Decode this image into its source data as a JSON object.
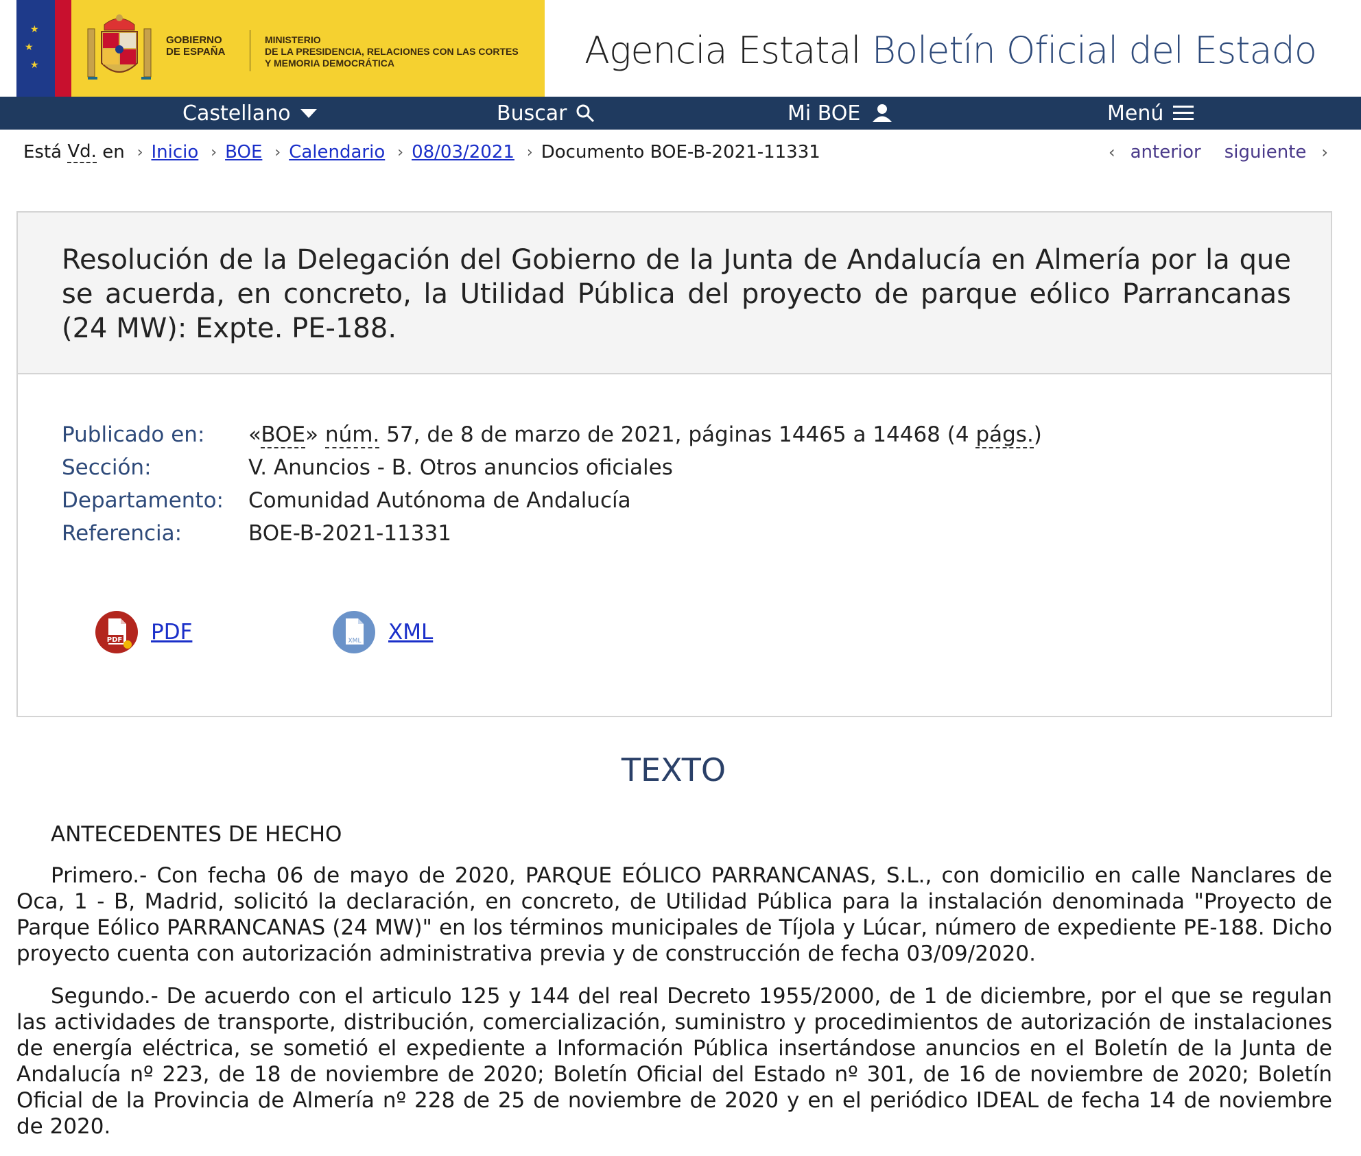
{
  "header": {
    "gov_line1": "GOBIERNO",
    "gov_line2": "DE ESPAÑA",
    "ministry_line1": "MINISTERIO",
    "ministry_line2": "DE LA PRESIDENCIA, RELACIONES CON LAS CORTES",
    "ministry_line3": "Y MEMORIA DEMOCRÁTICA",
    "site_title_prefix": "Agencia Estatal",
    "site_title_main": "Boletín Oficial del Estado"
  },
  "nav": {
    "language": "Castellano",
    "search": "Buscar",
    "my_boe": "Mi BOE",
    "menu": "Menú"
  },
  "breadcrumb": {
    "prefix_a": "Está",
    "prefix_abbr": "Vd.",
    "prefix_b": "en",
    "items": [
      "Inicio",
      "BOE",
      "Calendario",
      "08/03/2021"
    ],
    "current": "Documento BOE-B-2021-11331"
  },
  "pager": {
    "previous": "anterior",
    "next": "siguiente"
  },
  "document": {
    "title": "Resolución de la Delegación del Gobierno de la Junta de Andalucía en Almería por la que se acuerda, en concreto, la Utilidad Pública del proyecto de parque eólico Parrancanas (24 MW): Expte. PE-188.",
    "meta": {
      "published_label": "Publicado en:",
      "published_pre": "«",
      "published_boe": "BOE",
      "published_mid": "» ",
      "published_num": "núm.",
      "published_text": " 57, de 8 de marzo de 2021, páginas 14465 a 14468 (4 ",
      "published_pags": "págs.",
      "published_end": ")",
      "section_label": "Sección:",
      "section_value": "V. Anuncios - B. Otros anuncios oficiales",
      "department_label": "Departamento:",
      "department_value": "Comunidad Autónoma de Andalucía",
      "reference_label": "Referencia:",
      "reference_value": "BOE-B-2021-11331"
    },
    "downloads": {
      "pdf": "PDF",
      "xml": "XML",
      "pdf_icon_text": "PDF",
      "xml_icon_text": "XML"
    }
  },
  "text_section": {
    "heading": "TEXTO",
    "subheading": "ANTECEDENTES DE HECHO",
    "paragraphs": [
      "Primero.- Con fecha 06 de mayo de 2020, PARQUE EÓLICO PARRANCANAS, S.L., con domicilio en calle Nanclares de Oca, 1 - B, Madrid, solicitó la declaración, en concreto, de Utilidad Pública para la instalación denominada \"Proyecto de Parque Eólico PARRANCANAS (24 MW)\" en los términos municipales de Tíjola y Lúcar, número de expediente PE-188. Dicho proyecto cuenta con autorización administrativa previa y de construcción de fecha 03/09/2020.",
      "Segundo.- De acuerdo con el articulo 125 y 144 del real Decreto 1955/2000, de 1 de diciembre, por el que se regulan las actividades de transporte, distribución, comercialización, suministro y procedimientos de autorización de instalaciones de energía eléctrica, se sometió el expediente a Información Pública insertándose anuncios en el Boletín de la Junta de Andalucía nº 223, de 18 de noviembre de 2020; Boletín Oficial del Estado nº 301, de 16 de noviembre de 2020; Boletín Oficial de la Provincia de Almería nº 228 de 25 de noviembre de 2020 y en el periódico IDEAL de fecha 14 de noviembre de 2020."
    ]
  },
  "colors": {
    "nav_bg": "#1f3a5f",
    "gov_yellow": "#f5d130",
    "link": "#1a2fc9",
    "label_blue": "#2e4a7a"
  }
}
